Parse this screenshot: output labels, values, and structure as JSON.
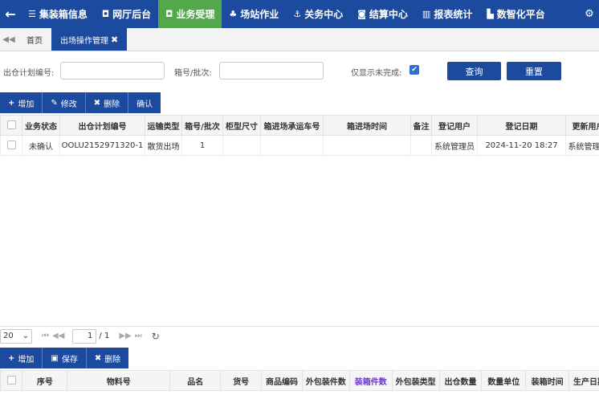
{
  "nav": {
    "items": [
      {
        "icon": "list-icon",
        "glyph": "☰",
        "label": "集装箱信息"
      },
      {
        "icon": "window-icon",
        "glyph": "◘",
        "label": "网厅后台"
      },
      {
        "icon": "window-icon",
        "glyph": "◘",
        "label": "业务受理"
      },
      {
        "icon": "cubes-icon",
        "glyph": "♣",
        "label": "场站作业"
      },
      {
        "icon": "anchor-icon",
        "glyph": "⚓",
        "label": "关务中心"
      },
      {
        "icon": "money-icon",
        "glyph": "◙",
        "label": "结算中心"
      },
      {
        "icon": "bar-chart-icon",
        "glyph": "▥",
        "label": "报表统计"
      },
      {
        "icon": "area-chart-icon",
        "glyph": "▙",
        "label": "数智化平台"
      }
    ]
  },
  "tabs": {
    "home": "首页",
    "current": "出场操作管理"
  },
  "search": {
    "plan_no_label": "出仓计划编号:",
    "plan_no_value": "",
    "box_no_label": "箱号/批次:",
    "box_no_value": "",
    "only_unfinished_label": "仅显示未完成:",
    "query_button": "查询",
    "reset_button": "重置"
  },
  "toolbar1": {
    "add": "增加",
    "edit": "修改",
    "delete": "删除",
    "confirm": "确认"
  },
  "grid1": {
    "columns": [
      "业务状态",
      "出仓计划编号",
      "运输类型",
      "箱号/批次",
      "柜型尺寸",
      "箱进场承运车号",
      "箱进场时间",
      "备注",
      "登记用户",
      "登记日期",
      "更新用户"
    ],
    "rows": [
      [
        "未确认",
        "OOLU2152971320-1",
        "散货出场",
        "1",
        "",
        "",
        "",
        "",
        "系统管理员",
        "2024-11-20 18:27",
        "系统管理员"
      ]
    ]
  },
  "pager": {
    "page_size": "20",
    "current_page": "1",
    "total_pages": "/ 1"
  },
  "toolbar2": {
    "add": "增加",
    "save": "保存",
    "delete": "删除"
  },
  "grid2": {
    "columns": [
      "序号",
      "物料号",
      "品名",
      "货号",
      "商品编码",
      "外包装件数",
      "装箱件数",
      "外包装类型",
      "出仓数量",
      "数量单位",
      "装箱时间",
      "生产日期"
    ]
  }
}
